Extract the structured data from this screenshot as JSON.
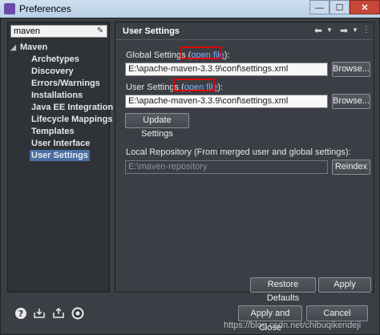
{
  "window": {
    "title": "Preferences",
    "min": "—",
    "max": "☐",
    "close": "✕"
  },
  "left": {
    "filter_value": "maven",
    "tree": {
      "root": "Maven",
      "children": [
        "Archetypes",
        "Discovery",
        "Errors/Warnings",
        "Installations",
        "Java EE Integration",
        "Lifecycle Mappings",
        "Templates",
        "User Interface",
        "User Settings"
      ]
    }
  },
  "right": {
    "title": "User Settings",
    "global_label": "Global Settings (",
    "global_link": "open file",
    "global_close": "):",
    "global_path": "E:\\apache-maven-3.3.9\\conf\\settings.xml",
    "user_label": "User Settings (",
    "user_link": "open file",
    "user_close": "):",
    "user_path": "E:\\apache-maven-3.3.9\\conf\\settings.xml",
    "browse_label": "Browse...",
    "update_label": "Update Settings",
    "local_repo_label": "Local Repository (From merged user and global settings):",
    "local_repo_path": "E:\\maven-repository",
    "reindex_label": "Reindex",
    "restore_label": "Restore Defaults",
    "apply_label": "Apply"
  },
  "footer": {
    "apply_close_label": "Apply and Close",
    "cancel_label": "Cancel",
    "watermark": "https://blog.csdn.net/chibuqikendeji"
  },
  "icons": {
    "help": "help-icon",
    "import": "import-icon",
    "export": "export-icon",
    "settings": "gear-icon"
  }
}
